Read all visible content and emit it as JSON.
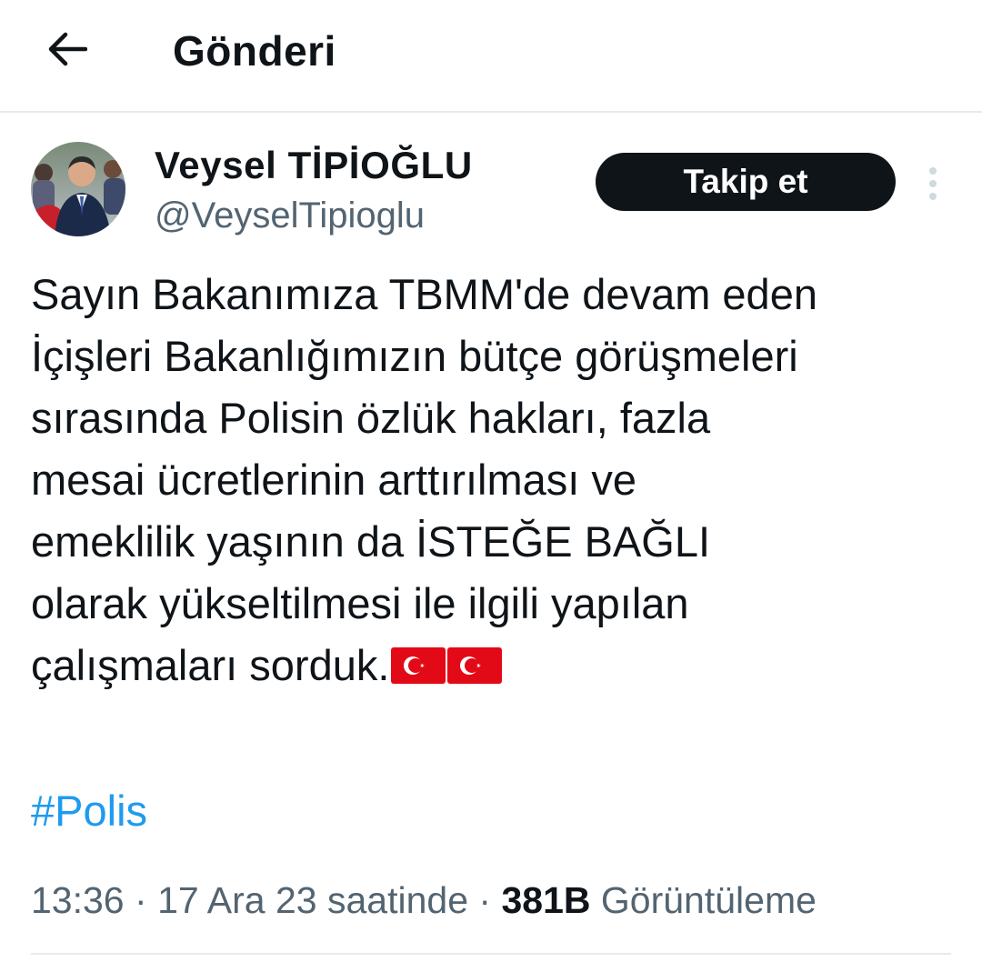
{
  "header": {
    "title": "Gönderi",
    "back_icon": "arrow-left-icon"
  },
  "author": {
    "display_name": "Veysel TİPİOĞLU",
    "handle": "@VeyselTipioglu",
    "follow_label": "Takip et",
    "more_icon": "vertical-dots-icon"
  },
  "tweet": {
    "lines": [
      "Sayın Bakanımıza TBMM'de devam eden",
      "İçişleri Bakanlığımızın bütçe görüşmeleri",
      "sırasında Polisin özlük hakları, fazla",
      "mesai ücretlerinin arttırılması ve",
      "emeklilik yaşının da İSTEĞE BAĞLI",
      "olarak yükseltilmesi ile ilgili yapılan",
      "çalışmaları sorduk."
    ],
    "emoji": [
      "turkey-flag-icon",
      "turkey-flag-icon"
    ],
    "hashtag": "#Polis"
  },
  "meta": {
    "time": "13:36",
    "separator": "·",
    "date": "17 Ara 23 saatinde",
    "views_count": "381B",
    "views_label": "Görüntüleme"
  },
  "colors": {
    "text": "#0f1419",
    "secondary": "#536471",
    "link": "#1d9bf0",
    "button_bg": "#0f1419",
    "divider": "#e6eaed",
    "flag_red": "#e30a17"
  }
}
